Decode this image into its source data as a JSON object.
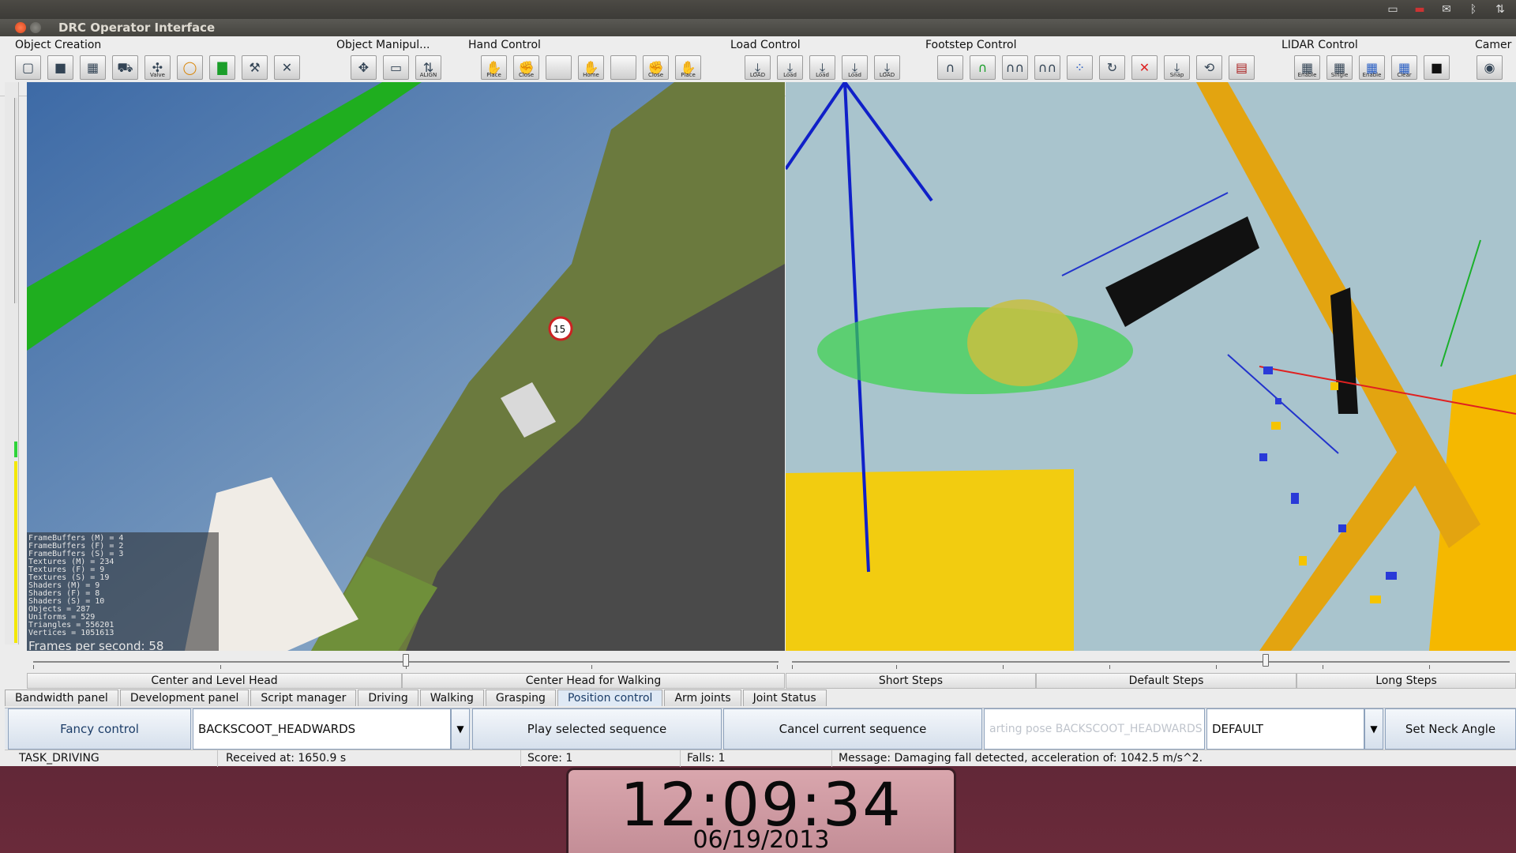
{
  "window": {
    "title": "DRC Operator Interface"
  },
  "toolbar": {
    "groups": [
      {
        "label": "Object Creation",
        "buttons": [
          "",
          "",
          "",
          "",
          "Valve",
          "",
          "",
          "",
          ""
        ]
      },
      {
        "label": "Object Manipul...",
        "buttons": [
          "",
          "",
          "ALIGN"
        ]
      },
      {
        "label": "Hand Control",
        "buttons": [
          "Place",
          "Close",
          "",
          "Home",
          "",
          "Close",
          "Place"
        ]
      },
      {
        "label": "Load Control",
        "buttons": [
          "LOAD",
          "Load",
          "Load",
          "Load",
          "LOAD"
        ]
      },
      {
        "label": "Footstep Control",
        "buttons": [
          "",
          "",
          "",
          "",
          "",
          "",
          "",
          "Snap",
          "",
          ""
        ]
      },
      {
        "label": "LIDAR Control",
        "buttons": [
          "Enable",
          "Single",
          "Enable",
          "Clear",
          ""
        ]
      },
      {
        "label": "Camer",
        "buttons": [
          ""
        ]
      }
    ]
  },
  "left_view": {
    "stats": [
      "FrameBuffers (M) = 4",
      "FrameBuffers (F) = 2",
      "FrameBuffers (S) = 3",
      "Textures (M) = 234",
      "Textures (F) = 9",
      "Textures (S) = 19",
      "Shaders (M) = 9",
      "Shaders (F) = 8",
      "Shaders (S) = 10",
      "Objects = 287",
      "Uniforms = 529",
      "Triangles = 556201",
      "Vertices = 1051613"
    ],
    "fps_text": "Frames per second: 58",
    "road_sign": "15"
  },
  "head_slider": {
    "value_fraction": 0.5
  },
  "steps_slider": {
    "value_fraction": 0.66
  },
  "head_presets": [
    "Center and Level Head",
    "Center Head for Walking"
  ],
  "step_presets": [
    "Short Steps",
    "Default Steps",
    "Long Steps"
  ],
  "tabs": [
    "Bandwidth panel",
    "Development panel",
    "Script manager",
    "Driving",
    "Walking",
    "Grasping",
    "Position control",
    "Arm joints",
    "Joint Status"
  ],
  "active_tab": "Position control",
  "control": {
    "fancy_label": "Fancy control",
    "sequence_value": "BACKSCOOT_HEADWARDS",
    "play_label": "Play selected sequence",
    "cancel_label": "Cancel current sequence",
    "starting_pose_placeholder": "arting pose BACKSCOOT_HEADWARDS",
    "mode_value": "DEFAULT",
    "neck_label": "Set Neck Angle"
  },
  "status": {
    "task": "TASK_DRIVING",
    "received": "Received at:  1650.9 s",
    "score": "Score:  1",
    "falls": "Falls:  1",
    "message": "Message:  Damaging fall detected, acceleration of: 1042.5 m/s^2."
  },
  "clock": {
    "time": "12:09:34",
    "date": "06/19/2013"
  },
  "colors": {
    "active_tab": "#dfe9f5",
    "control_bg": "#e3e8ee",
    "clock_bg": "#d9a6ad",
    "robot_green": "#2fd43a",
    "lidar_yellow": "#f5c400"
  }
}
